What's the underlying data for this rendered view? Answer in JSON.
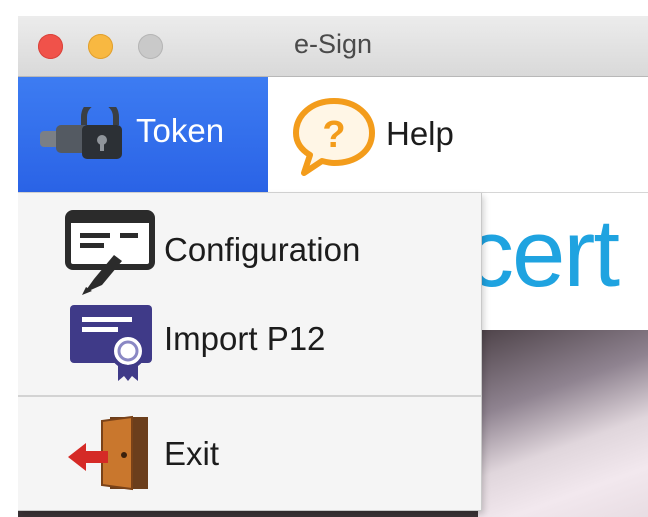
{
  "window": {
    "title": "e-Sign"
  },
  "menubar": {
    "token_label": "Token",
    "help_label": "Help"
  },
  "dropdown": {
    "items": [
      {
        "label": "Configuration",
        "icon": "configuration-icon"
      },
      {
        "label": "Import P12",
        "icon": "certificate-icon"
      },
      {
        "label": "Exit",
        "icon": "exit-door-icon"
      }
    ]
  },
  "background": {
    "logo_text": "cert"
  },
  "colors": {
    "menu_selected": "#2f6beb",
    "logo": "#1fa3e0",
    "help_icon": "#f39c1b"
  }
}
